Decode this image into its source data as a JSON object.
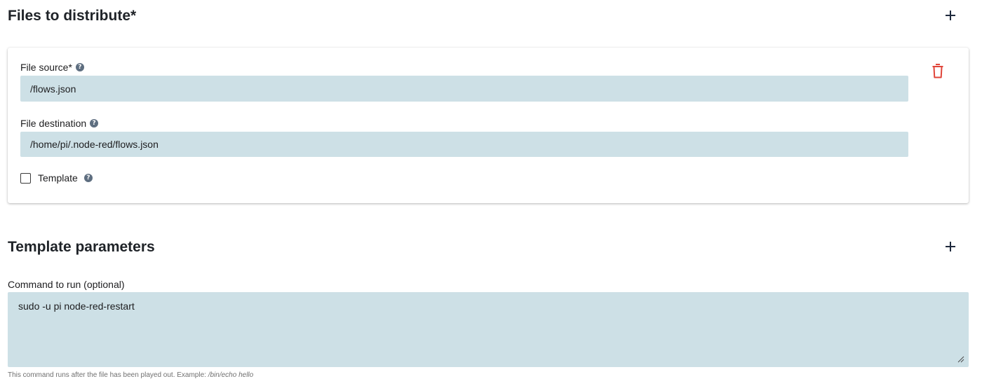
{
  "files_section": {
    "title": "Files to distribute*",
    "add_icon": "plus-icon"
  },
  "file_entry": {
    "source_label": "File source*",
    "source_value": "/flows.json",
    "destination_label": "File destination",
    "destination_value": "/home/pi/.node-red/flows.json",
    "template_label": "Template",
    "template_checked": false,
    "help_icon": "question-circle-icon",
    "delete_icon": "trash-icon"
  },
  "template_section": {
    "title": "Template parameters",
    "add_icon": "plus-icon"
  },
  "command": {
    "label": "Command to run (optional)",
    "value": "sudo -u pi node-red-restart",
    "helper_prefix": "This command runs after the file has been played out. Example: ",
    "helper_example": "/bin/echo hello"
  },
  "colors": {
    "input_background": "#cde0e6",
    "delete_icon": "#e0453a",
    "help_icon": "#5e6e80",
    "heading_text": "#1f2328"
  }
}
